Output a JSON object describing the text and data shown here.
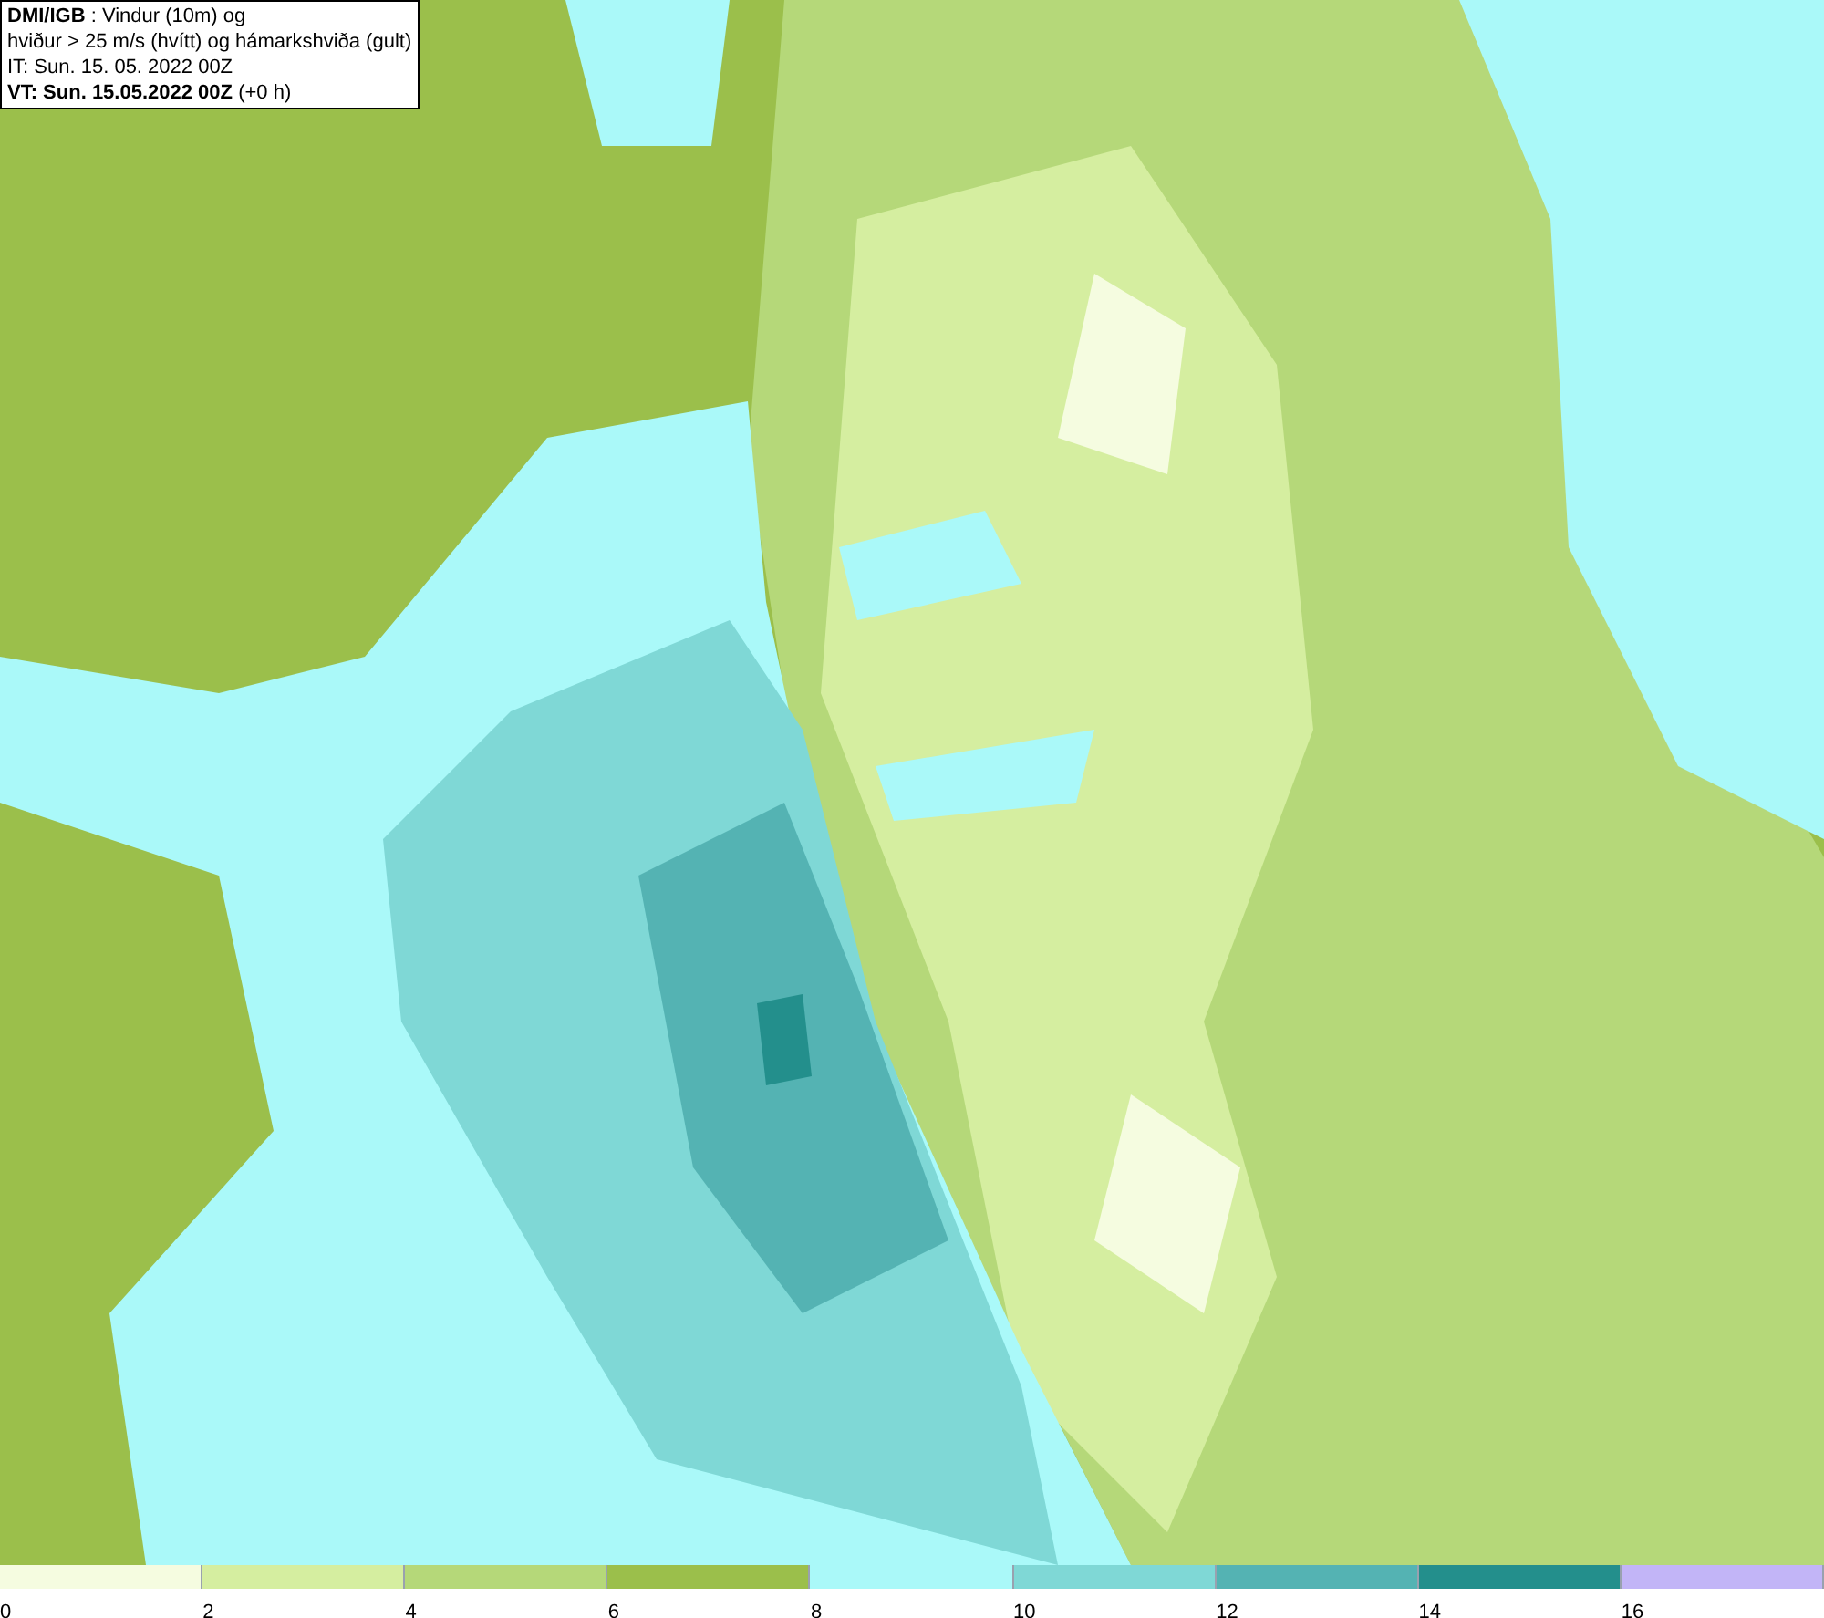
{
  "title_box": {
    "lines": [
      "**DMI/IGB** : Vindur (10m) og",
      "hviður > 25 m/s (hvítt) og hámarkshviða (gult)",
      "IT: Sun. 15. 05. 2022 00Z",
      "**VT: Sun. 15.05.2022 00Z** (+0 h)"
    ]
  },
  "legend": {
    "bins": [
      {
        "label": "0",
        "color": "#f5fce0"
      },
      {
        "label": "2",
        "color": "#d5eea0"
      },
      {
        "label": "4",
        "color": "#b5d879"
      },
      {
        "label": "6",
        "color": "#9bbf4b"
      },
      {
        "label": "8",
        "color": "#aaf9f9"
      },
      {
        "label": "10",
        "color": "#7fd8d6"
      },
      {
        "label": "12",
        "color": "#54b3b3"
      },
      {
        "label": "14",
        "color": "#238f8c"
      },
      {
        "label": "16",
        "color": "#c2b5f7"
      }
    ]
  }
}
